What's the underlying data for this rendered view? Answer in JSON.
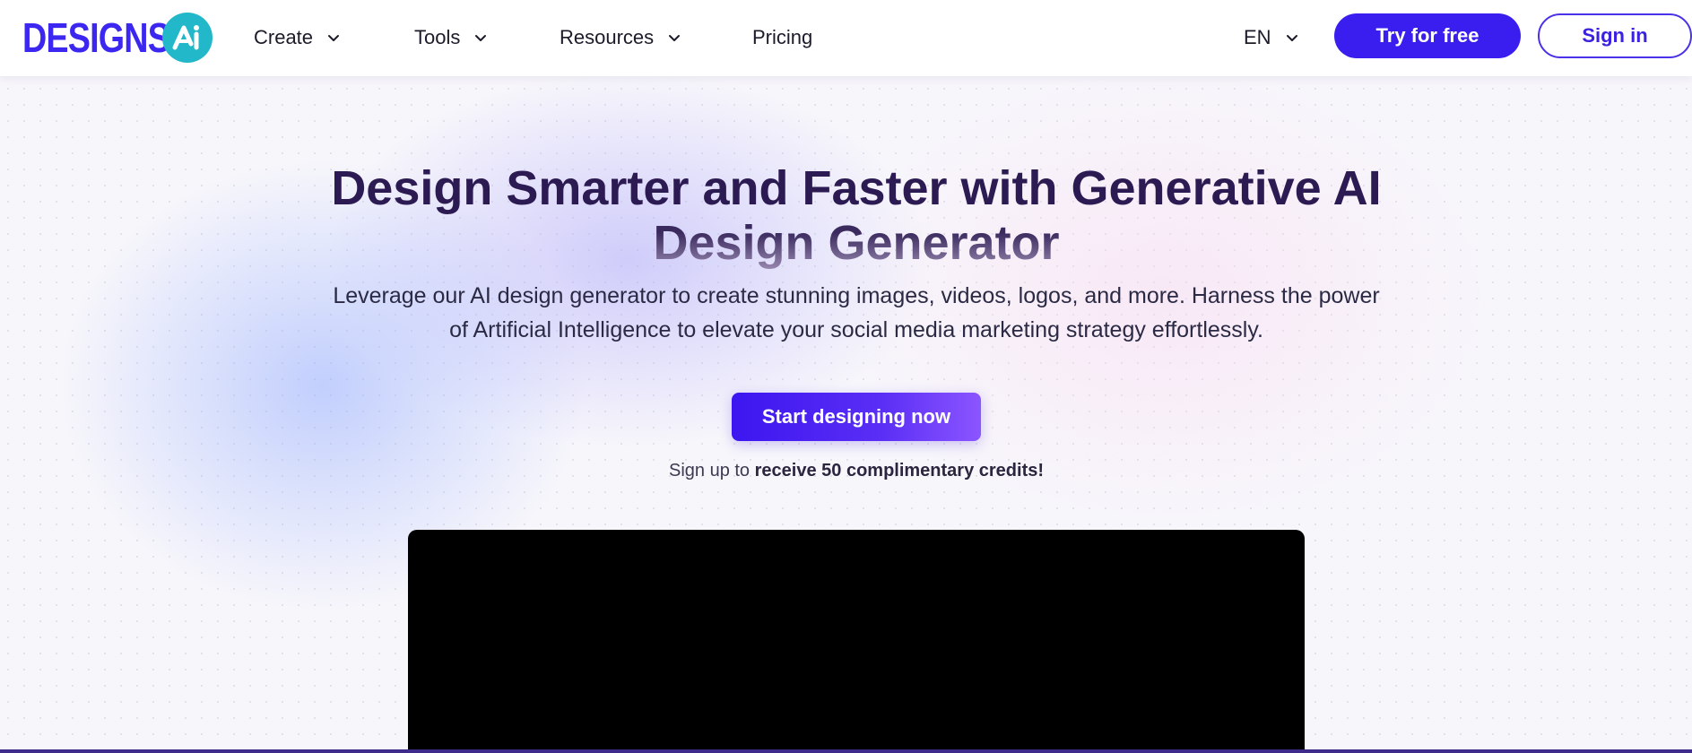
{
  "header": {
    "logo_text": "DESIGNS.",
    "logo_badge": "AI",
    "nav": [
      {
        "label": "Create",
        "has_dropdown": true
      },
      {
        "label": "Tools",
        "has_dropdown": true
      },
      {
        "label": "Resources",
        "has_dropdown": true
      },
      {
        "label": "Pricing",
        "has_dropdown": false
      }
    ],
    "language": "EN",
    "try_button": "Try for free",
    "signin_button": "Sign in"
  },
  "hero": {
    "title_line1": "Design Smarter and Faster with Generative AI",
    "title_line2": "Design Generator",
    "subtitle_line1": "Leverage our AI design generator to create stunning images, videos, logos, and more. Harness the power",
    "subtitle_line2": "of Artificial Intelligence to elevate your social media marketing strategy effortlessly.",
    "cta": "Start designing now",
    "signup_prefix": "Sign up to",
    "signup_bold": "receive 50 complimentary credits!"
  },
  "icons": {
    "dropdown": "chevron-down-icon",
    "logo_badge": "ai-badge-icon"
  },
  "colors": {
    "brand": "#3a1ef0",
    "logo": "#3b27f0",
    "badge": "#22b8c9",
    "title": "#2c1a52",
    "video": "#000000"
  }
}
